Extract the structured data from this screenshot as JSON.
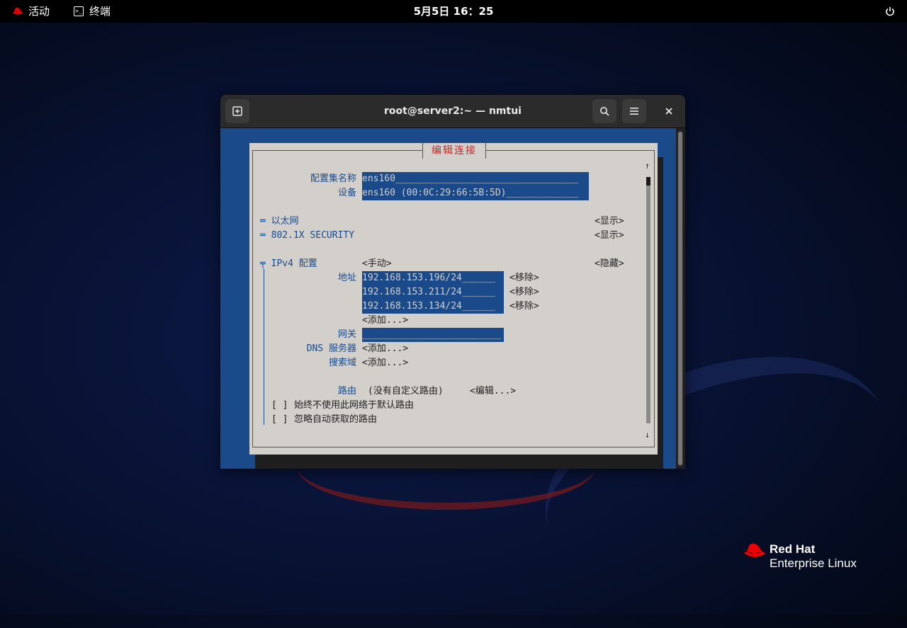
{
  "topbar": {
    "activities": "活动",
    "app_name": "终端",
    "clock": "5月5日 16：25"
  },
  "window": {
    "title": "root@server2:~ — nmtui"
  },
  "dialog": {
    "title": "编辑连接",
    "profile_label": "配置集名称",
    "profile_value": "ens160_________________________________",
    "device_label": "设备",
    "device_value": "ens160 (00:0C:29:66:5B:5D)_____________",
    "ethernet": "═ 以太网",
    "security": "═ 802.1X SECURITY",
    "show": "<显示>",
    "ipv4_label": "╤ IPv4 配置",
    "ipv4_mode": "<手动>",
    "hide": "<隐藏>",
    "address_label": "地址",
    "addresses": [
      "192.168.153.196/24______",
      "192.168.153.211/24______",
      "192.168.153.134/24______"
    ],
    "remove": "<移除>",
    "add": "<添加...>",
    "gateway_label": "网关",
    "gateway_value": "_________________________",
    "dns_label": "DNS 服务器",
    "search_label": "搜索域",
    "routes_label": "路由",
    "routes_value": "(没有自定义路由)",
    "edit": "<编辑...>",
    "checkbox": "[ ]",
    "never_default": "始终不使用此网络于默认路由",
    "ignore_routes": "忽略自动获取的路由",
    "scroll_up": "↑",
    "scroll_down": "↓"
  },
  "logo": {
    "brand": "Red Hat",
    "product": "Enterprise Linux"
  },
  "colors": {
    "term_blue": "#1a4a8a",
    "dialog_bg": "#d3d0cc",
    "title_red": "#c3272b"
  }
}
